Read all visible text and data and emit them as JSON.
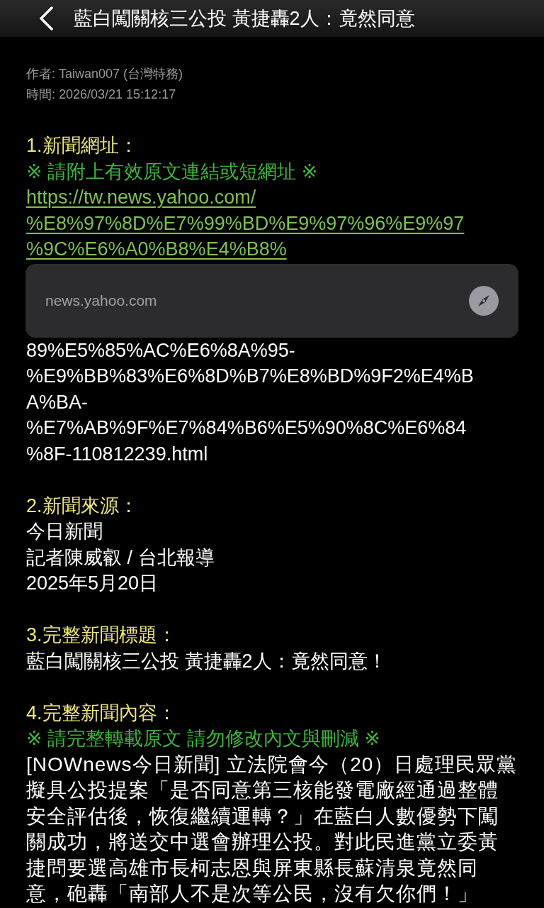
{
  "header": {
    "title": "藍白闖關核三公投 黃捷轟2人：竟然同意"
  },
  "meta": [
    "作者: Taiwan007 (台灣特務)",
    "時間: 2026/03/21 15:12:17"
  ],
  "sections": [
    {
      "heading": "1.新聞網址：",
      "blocks": [
        {
          "kind": "notice",
          "text": "※ 請附上有效原文連結或短網址 ※"
        },
        {
          "kind": "link",
          "text": "https://tw.news.yahoo.com/"
        },
        {
          "kind": "link",
          "text": "%E8%97%8D%E7%99%BD%E9%97%96%E9%97"
        },
        {
          "kind": "link",
          "text": "%9C%E6%A0%B8%E4%B8%"
        },
        {
          "kind": "preview",
          "text": "news.yahoo.com"
        },
        {
          "kind": "text",
          "text": "89%E5%85%AC%E6%8A%95-"
        },
        {
          "kind": "text",
          "text": "%E9%BB%83%E6%8D%B7%E8%BD%9F2%E4%B"
        },
        {
          "kind": "text",
          "text": "A%BA-"
        },
        {
          "kind": "text",
          "text": "%E7%AB%9F%E7%84%B6%E5%90%8C%E6%84"
        },
        {
          "kind": "text",
          "text": "%8F-110812239.html"
        }
      ]
    },
    {
      "heading": "2.新聞來源：",
      "blocks": [
        {
          "kind": "text",
          "text": "今日新聞"
        },
        {
          "kind": "text",
          "text": "記者陳威叡 / 台北報導"
        },
        {
          "kind": "text",
          "text": "2025年5月20日"
        }
      ]
    },
    {
      "heading": "3.完整新聞標題：",
      "blocks": [
        {
          "kind": "text",
          "text": "藍白闖關核三公投 黃捷轟2人：竟然同意！"
        }
      ]
    },
    {
      "heading": "4.完整新聞內容：",
      "blocks": [
        {
          "kind": "notice",
          "text": "※ 請完整轉載原文 請勿修改內文與刪減 ※"
        },
        {
          "kind": "paragraph",
          "text": "[NOWnews今日新聞] 立法院會今（20）日處理民眾黨擬具公投提案「是否同意第三核能發電廠經通過整體安全評估後，恢復繼續運轉？」在藍白人數優勢下闖關成功，將送交中選會辦理公投。對此民進黨立委黃捷問要選高雄市長柯志恩與屏東縣長蘇清泉竟然同意，砲轟「南部人不是次等公民，沒有欠你們！」"
        }
      ]
    }
  ]
}
